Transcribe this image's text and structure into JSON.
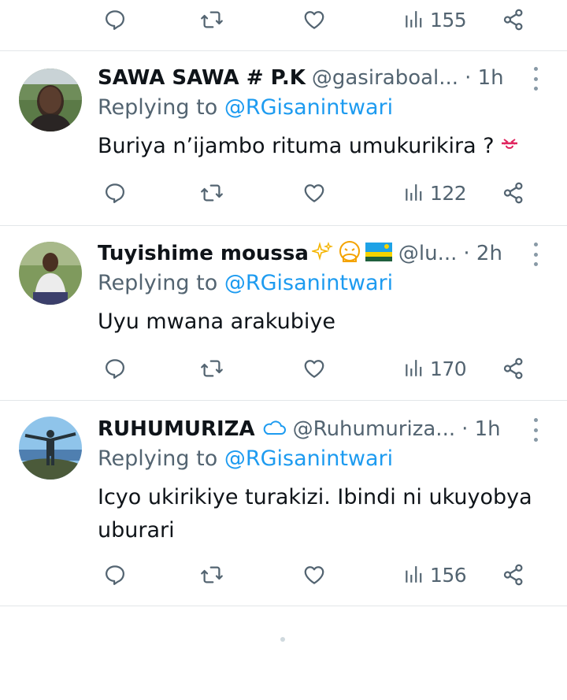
{
  "top_actions": {
    "views": "155"
  },
  "tweets": [
    {
      "display_name": "SAWA SAWA # P.K",
      "handle": "@gasiraboal...",
      "time": "· 1h",
      "replying_prefix": "Replying to ",
      "replying_to": "@RGisanintwari",
      "text": "Buriya n’ijambo rituma umukurikira ?",
      "views": "122"
    },
    {
      "display_name": "Tuyishime moussa",
      "handle": "@lu...",
      "time": "· 2h",
      "replying_prefix": "Replying to ",
      "replying_to": "@RGisanintwari",
      "text": "Uyu mwana arakubiye",
      "views": "170"
    },
    {
      "display_name": "RUHUMURIZA",
      "handle": "@Ruhumuriza...",
      "time": "· 1h",
      "replying_prefix": "Replying to ",
      "replying_to": "@RGisanintwari",
      "text": "Icyo ukirikiye turakizi. Ibindi ni ukuyobya uburari",
      "views": "156"
    }
  ],
  "colors": {
    "link": "#1d9bf0",
    "secondary": "#536471",
    "divider": "#e3e6e9"
  },
  "icons": [
    "reply-icon",
    "retweet-icon",
    "like-icon",
    "views-icon",
    "share-icon",
    "more-icon",
    "sparkles-emoji",
    "hand-over-mouth-emoji",
    "rwanda-flag-emoji",
    "cloud-emoji",
    "face-emoji"
  ]
}
